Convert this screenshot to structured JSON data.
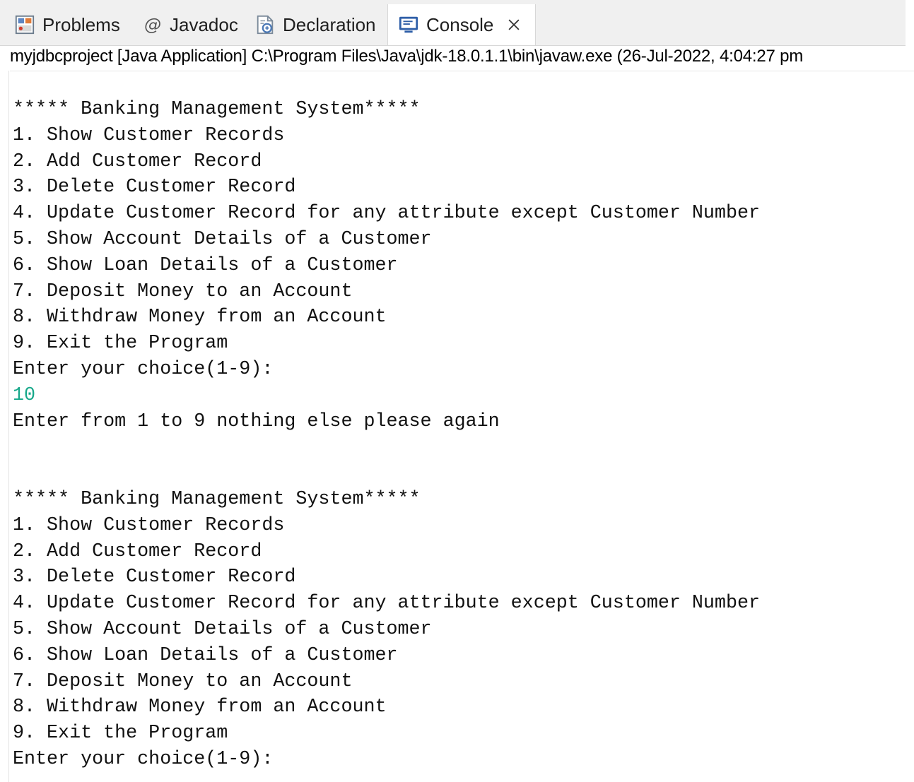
{
  "tabs": [
    {
      "label": "Problems",
      "icon": "problems-icon",
      "active": false
    },
    {
      "label": "Javadoc",
      "icon": "javadoc-at-icon",
      "active": false
    },
    {
      "label": "Declaration",
      "icon": "declaration-icon",
      "active": false
    },
    {
      "label": "Console",
      "icon": "console-icon",
      "active": true,
      "closable": true
    }
  ],
  "launch": {
    "text": "myjdbcproject [Java Application] C:\\Program Files\\Java\\jdk-18.0.1.1\\bin\\javaw.exe  (26-Jul-2022, 4:04:27 pm"
  },
  "console": {
    "input_color": "#17a88a",
    "blocks": [
      {
        "header": "***** Banking Management System*****",
        "menu": [
          "1. Show Customer Records",
          "2. Add Customer Record",
          "3. Delete Customer Record",
          "4. Update Customer Record for any attribute except Customer Number",
          "5. Show Account Details of a Customer",
          "6. Show Loan Details of a Customer",
          "7. Deposit Money to an Account",
          "8. Withdraw Money from an Account",
          "9. Exit the Program"
        ],
        "prompt": "Enter your choice(1-9):",
        "input": "10",
        "message": "Enter from 1 to 9 nothing else please again"
      },
      {
        "header": "***** Banking Management System*****",
        "menu": [
          "1. Show Customer Records",
          "2. Add Customer Record",
          "3. Delete Customer Record",
          "4. Update Customer Record for any attribute except Customer Number",
          "5. Show Account Details of a Customer",
          "6. Show Loan Details of a Customer",
          "7. Deposit Money to an Account",
          "8. Withdraw Money from an Account",
          "9. Exit the Program"
        ],
        "prompt": "Enter your choice(1-9):"
      }
    ]
  }
}
